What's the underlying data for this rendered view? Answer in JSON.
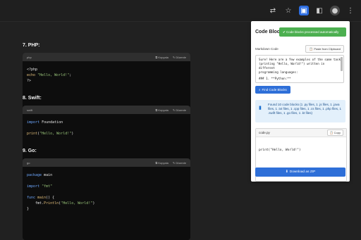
{
  "toolbar": {
    "icons": [
      "translate-icon",
      "star-icon",
      "extension-icon",
      "extension-icon-2",
      "profile-icon",
      "more-icon"
    ]
  },
  "sections": [
    {
      "title": "7. PHP:",
      "lang": "php",
      "copy": "Kopyala",
      "edit": "Düzenle",
      "lines": [
        "<?php",
        "echo \"Hello, World!\";",
        "?>"
      ]
    },
    {
      "title": "8. Swift:",
      "lang": "swift",
      "copy": "Kopyala",
      "edit": "Düzenle",
      "lines": [
        "import Foundation",
        "",
        "print(\"Hello, World!\")"
      ]
    },
    {
      "title": "9. Go:",
      "lang": "go",
      "copy": "Kopyala",
      "edit": "Düzenle",
      "lines": [
        "package main",
        "",
        "import \"fmt\"",
        "",
        "func main() {",
        "    fmt.Println(\"Hello, World!\")",
        "}"
      ]
    }
  ],
  "panel": {
    "title": "Code Blocks",
    "toast": "Code blocks processed automatically",
    "markdown_label": "Markdown Code",
    "paste_label": "Paste from Clipboard",
    "markdown_text": [
      "Sure! Here are a few examples of the same task",
      "(printing \"Hello, World!\") written in different",
      "programming languages:",
      "",
      "### 1. **Python:**"
    ],
    "find_label": "Find Code Blocks",
    "info_text": "Found 10 code blocks (1 .py files, 1 .js files, 1 .java files, 1 .txt files, 1 .cpp files, 1 .cs files, 1 .php files, 1 .swift files, 1 .go files, 1 .kt files)",
    "file_name": "code.py",
    "copy_label": "Copy",
    "file_code": "print(\"Hello, World!\")",
    "download_label": "Download as ZIP"
  }
}
